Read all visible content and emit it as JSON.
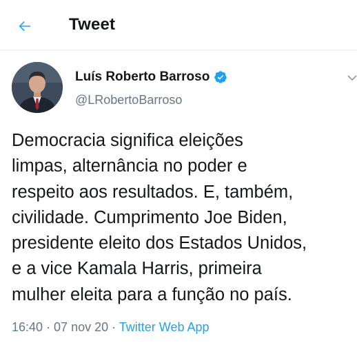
{
  "header": {
    "back_icon": "arrow-left-icon",
    "title": "Tweet"
  },
  "author": {
    "name": "Luís Roberto Barroso",
    "handle": "@LRobertoBarroso",
    "verified_icon": "verified-badge-icon"
  },
  "tweet": {
    "lines": [
      "Democracia significa eleições",
      "limpas, alternância no poder e",
      "respeito aos resultados. E, também,",
      "civilidade. Cumprimento Joe Biden,",
      "presidente eleito dos Estados Unidos,",
      "e a vice Kamala Harris, primeira",
      "mulher eleita para a função no país."
    ]
  },
  "meta": {
    "time": "16:40",
    "separator": " · ",
    "date": "07 nov 20",
    "source": "Twitter Web App"
  },
  "colors": {
    "accent": "#1da1f2",
    "text": "#14171a",
    "secondary": "#657786",
    "divider": "#e6ecf0"
  }
}
